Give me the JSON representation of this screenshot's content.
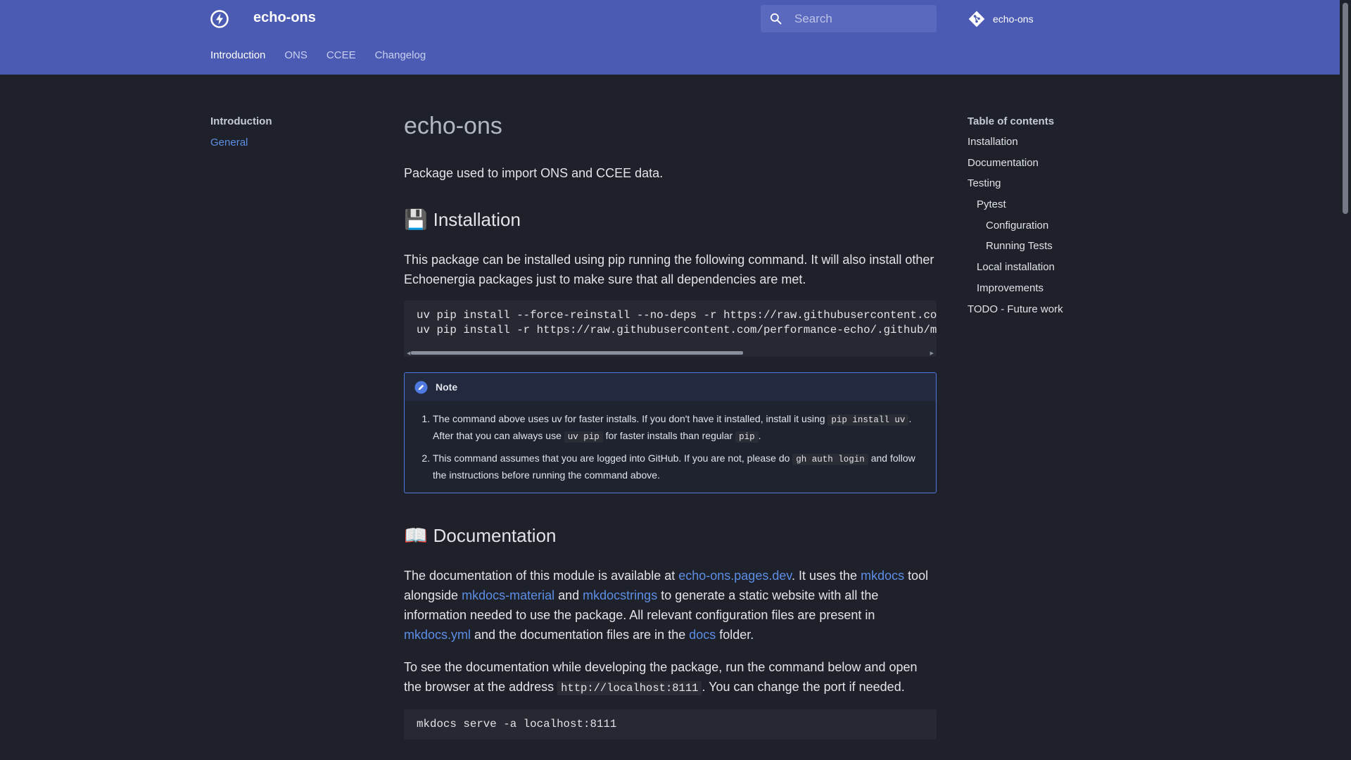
{
  "header": {
    "site_title": "echo-ons",
    "search_placeholder": "Search",
    "repo_name": "echo-ons",
    "tabs": [
      {
        "label": "Introduction",
        "active": true
      },
      {
        "label": "ONS",
        "active": false
      },
      {
        "label": "CCEE",
        "active": false
      },
      {
        "label": "Changelog",
        "active": false
      }
    ]
  },
  "nav_left": {
    "title": "Introduction",
    "items": [
      {
        "label": "General"
      }
    ]
  },
  "toc": {
    "title": "Table of contents",
    "items": [
      {
        "label": "Installation",
        "level": 1
      },
      {
        "label": "Documentation",
        "level": 1
      },
      {
        "label": "Testing",
        "level": 1
      },
      {
        "label": "Pytest",
        "level": 2
      },
      {
        "label": "Configuration",
        "level": 3
      },
      {
        "label": "Running Tests",
        "level": 3
      },
      {
        "label": "Local installation",
        "level": 2
      },
      {
        "label": "Improvements",
        "level": 2
      },
      {
        "label": "TODO - Future work",
        "level": 1
      }
    ]
  },
  "content": {
    "title": "echo-ons",
    "intro": "Package used to import ONS and CCEE data.",
    "installation": {
      "emoji": "💾",
      "heading": "Installation",
      "paragraph": "This package can be installed using pip running the following command. It will also install other Echoenergia packages just to make sure that all dependencies are met.",
      "code_lines": [
        "uv pip install --force-reinstall --no-deps -r https://raw.githubusercontent.com/pe",
        "uv pip install -r https://raw.githubusercontent.com/performance-echo/.github/main/"
      ],
      "note": {
        "title": "Note",
        "item1": {
          "a": "The command above uses uv for faster installs. If you don't have it installed, install it using ",
          "code1": "pip install uv",
          "b": ". After that you can always use ",
          "code2": "uv pip",
          "c": " for faster installs than regular ",
          "code3": "pip",
          "d": "."
        },
        "item2": {
          "a": "This command assumes that you are logged into GitHub. If you are not, please do ",
          "code1": "gh auth login",
          "b": " and follow the instructions before running the command above."
        }
      }
    },
    "documentation": {
      "emoji": "📖",
      "heading": "Documentation",
      "p1": {
        "a": "The documentation of this module is available at ",
        "link1": "echo-ons.pages.dev",
        "b": ". It uses the ",
        "link2": "mkdocs",
        "c": " tool alongside ",
        "link3": "mkdocs-material",
        "d": " and ",
        "link4": "mkdocstrings",
        "e": " to generate a static website with all the information needed to use the package. All relevant configuration files are present in ",
        "link5": "mkdocs.yml",
        "f": " and the documentation files are in the ",
        "link6": "docs",
        "g": " folder."
      },
      "p2": {
        "a": "To see the documentation while developing the package, run the command below and open the browser at the address ",
        "code": "http://localhost:8111",
        "b": ". You can change the port if needed."
      },
      "code": "mkdocs serve -a localhost:8111"
    }
  }
}
